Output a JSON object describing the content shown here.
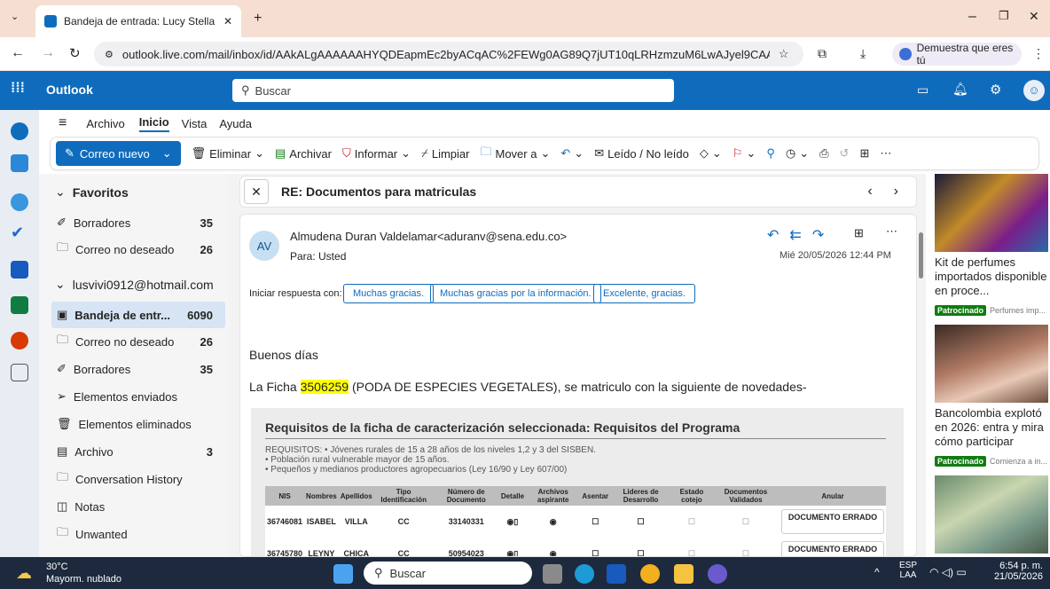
{
  "browser": {
    "tab_title": "Bandeja de entrada: Lucy Stella",
    "url": "outlook.live.com/mail/inbox/id/AAkALgAAAAAAHYQDEapmEc2byACqAC%2FEWg0AG89Q7jUT10qLRHzmzuM6LwAJyel9CAAA",
    "profile_label": "Demuestra que eres tú"
  },
  "outlook": {
    "app_name": "Outlook",
    "search_placeholder": "Buscar",
    "menu": [
      "Archivo",
      "Inicio",
      "Vista",
      "Ayuda"
    ],
    "toolbar": {
      "new_mail": "Correo nuevo",
      "delete": "Eliminar",
      "archive": "Archivar",
      "report": "Informar",
      "sweep": "Limpiar",
      "move": "Mover a",
      "read_unread": "Leído / No leído"
    }
  },
  "folders": {
    "favorites_title": "Favoritos",
    "favorites": [
      {
        "label": "Borradores",
        "count": "35"
      },
      {
        "label": "Correo no deseado",
        "count": "26"
      }
    ],
    "account": "lusvivi0912@hotmail.com",
    "items": [
      {
        "label": "Bandeja de entr...",
        "count": "6090"
      },
      {
        "label": "Correo no deseado",
        "count": "26"
      },
      {
        "label": "Borradores",
        "count": "35"
      },
      {
        "label": "Elementos enviados",
        "count": ""
      },
      {
        "label": "Elementos eliminados",
        "count": ""
      },
      {
        "label": "Archivo",
        "count": "3"
      },
      {
        "label": "Conversation History",
        "count": ""
      },
      {
        "label": "Notas",
        "count": ""
      },
      {
        "label": "Unwanted",
        "count": ""
      }
    ]
  },
  "email": {
    "subject": "RE: Documentos para matriculas",
    "avatar_initials": "AV",
    "from": "Almudena Duran Valdelamar<aduranv@sena.edu.co>",
    "to": "Para:  Usted",
    "date": "Mié 20/05/2026 12:44 PM",
    "quick_reply_label": "Iniciar respuesta con:",
    "quick_replies": [
      "Muchas gracias.",
      "Muchas gracias por la información.",
      "Excelente, gracias."
    ],
    "greeting": "Buenos días",
    "body_prefix": "La Ficha ",
    "ficha": "3506259",
    "body_suffix": " (PODA DE ESPECIES VEGETALES), se matriculo con la siguiente de novedades-",
    "req_title": "Requisitos de la ficha de caracterización seleccionada: Requisitos del Programa",
    "req_lines": [
      "REQUISITOS: • Jóvenes rurales de 15 a 28 años de los niveles 1,2 y 3 del SISBEN.",
      "• Población rural vulnerable mayor de 15 años.",
      "• Pequeños y medianos productores agropecuarios (Ley 16/90 y Ley 607/00)"
    ],
    "table_headers": [
      "NIS",
      "Nombres",
      "Apellidos",
      "Tipo Identificación",
      "Número de Documento",
      "Detalle",
      "Archivos aspirante",
      "Asentar",
      "Lideres de Desarrollo",
      "Estado cotejo",
      "Documentos Validados",
      "Anular"
    ],
    "rows": [
      {
        "nis": "36746081",
        "nombres": "ISABEL",
        "apellidos": "VILLA",
        "tipo": "CC",
        "doc": "33140331",
        "anular": "DOCUMENTO ERRADO"
      },
      {
        "nis": "36745780",
        "nombres": "LEYNY",
        "apellidos": "CHICA",
        "tipo": "CC",
        "doc": "50954023",
        "anular": "DOCUMENTO ERRADO"
      }
    ]
  },
  "ads": [
    {
      "title": "Kit de perfumes importados disponible en proce...",
      "sponsor": "Patrocinado",
      "source": "Perfumes imp..."
    },
    {
      "title": "Bancolombia explotó en 2026: entra y mira cómo participar",
      "sponsor": "Patrocinado",
      "source": "Comienza a in..."
    }
  ],
  "taskbar": {
    "weather_temp": "30°C",
    "weather_desc": "Mayorm. nublado",
    "search": "Buscar",
    "lang": "ESP",
    "lang2": "LAA",
    "time": "6:54 p. m.",
    "date": "21/05/2026"
  },
  "colors": {
    "brand": "#0f6cbd",
    "highlight": "#ffff00",
    "sponsored": "#107c10"
  }
}
